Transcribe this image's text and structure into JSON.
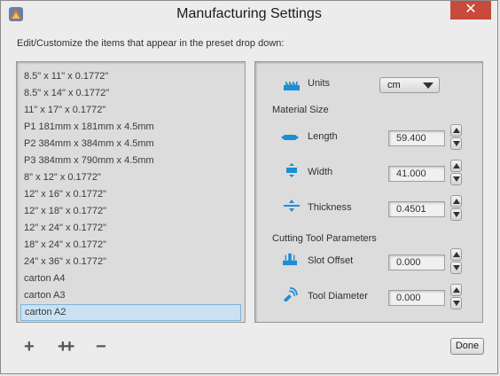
{
  "window": {
    "title": "Manufacturing Settings",
    "close_label": "✕"
  },
  "hint": "Edit/Customize the items that appear in the preset drop down:",
  "presets": [
    "8.5\" x 11\" x 0.1772\"",
    "8.5\" x 14\" x 0.1772\"",
    "11\" x 17\" x 0.1772\"",
    "P1 181mm x 181mm x 4.5mm",
    "P2 384mm x 384mm x 4.5mm",
    "P3 384mm x 790mm x 4.5mm",
    "8\" x 12\" x 0.1772\"",
    "12\" x 16\" x 0.1772\"",
    "12\" x 18\" x 0.1772\"",
    "12\" x 24\" x 0.1772\"",
    "18\" x 24\" x 0.1772\"",
    "24\" x 36\" x 0.1772\"",
    "carton A4",
    "carton A3",
    "carton A2"
  ],
  "selected_preset": "carton A2",
  "settings": {
    "units_label": "Units",
    "units_value": "cm",
    "material_size_heading": "Material Size",
    "length_label": "Length",
    "length_value": "59.400",
    "width_label": "Width",
    "width_value": "41.000",
    "thickness_label": "Thickness",
    "thickness_value": "0.4501",
    "cutting_tool_heading": "Cutting Tool Parameters",
    "slot_offset_label": "Slot Offset",
    "slot_offset_value": "0.000",
    "tool_diameter_label": "Tool Diameter",
    "tool_diameter_value": "0.000"
  },
  "buttons": {
    "add": "+",
    "add_multiple": "++",
    "remove": "−",
    "done": "Done"
  },
  "colors": {
    "accent_blue": "#1a8fd6",
    "close_red": "#c74a3d",
    "selection": "#c9e1f3"
  }
}
